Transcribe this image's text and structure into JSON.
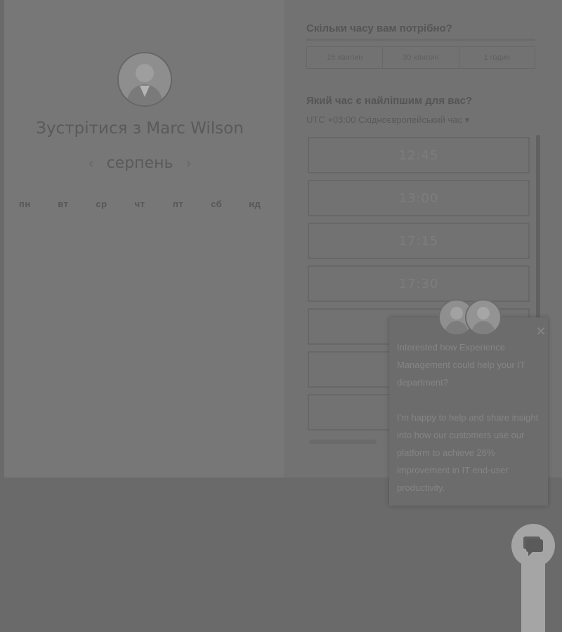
{
  "host": {
    "title": "Зустрітися з Marc Wilson",
    "avatar_icon": "person-avatar-icon"
  },
  "calendar": {
    "month_label": "серпень",
    "prev_arrow": "‹",
    "next_arrow": "›",
    "weekdays": [
      "пн",
      "вт",
      "ср",
      "чт",
      "пт",
      "сб",
      "нд"
    ]
  },
  "duration": {
    "question": "Скільки часу вам потрібно?",
    "options": [
      "15 хвилин",
      "30 хвилин",
      "1 годин"
    ]
  },
  "time": {
    "question": "Який час є найліпшим для вас?",
    "timezone": "UTC +03:00 Східноєвропейський час ▾",
    "slots": [
      "12:45",
      "13:00",
      "17:15",
      "17:30"
    ]
  },
  "chat": {
    "close_label": "✕",
    "message_1": "Interested how Experience Management could help your IT department?",
    "message_2": "I'm happy to help and share insight into how our customers use our platform to achieve 26% improvement in IT end-user productivity."
  }
}
